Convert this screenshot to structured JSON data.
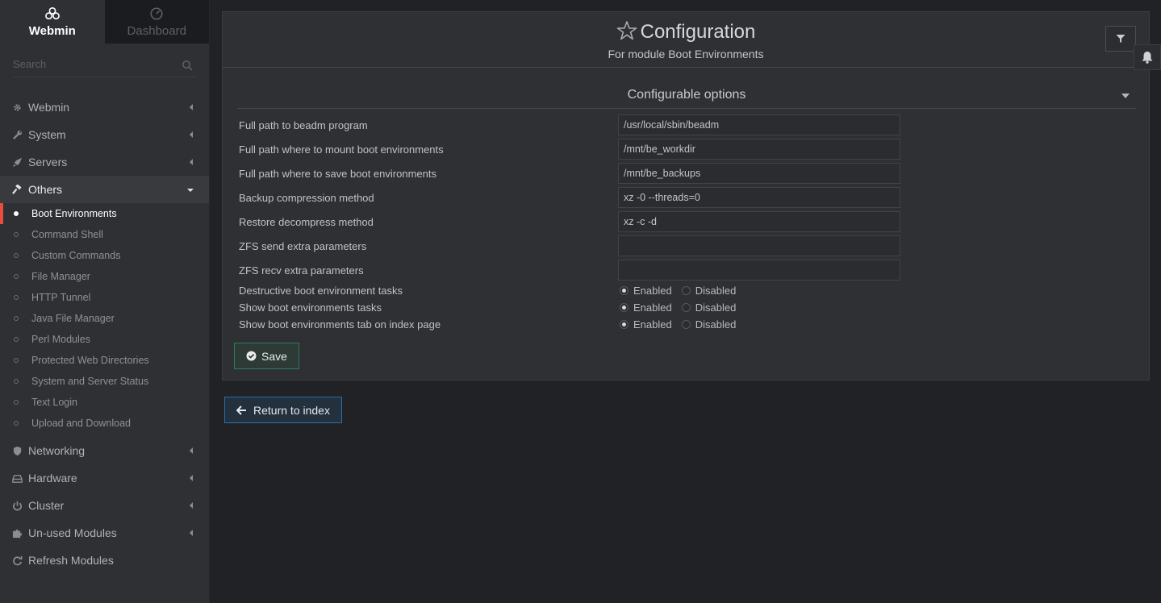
{
  "topnav": {
    "webmin_label": "Webmin",
    "dashboard_label": "Dashboard"
  },
  "search": {
    "placeholder": "Search"
  },
  "menu": {
    "categories_top": [
      {
        "label": "Webmin",
        "icon": "gear-icon"
      },
      {
        "label": "System",
        "icon": "wrench-icon"
      },
      {
        "label": "Servers",
        "icon": "rocket-icon"
      }
    ],
    "others": {
      "label": "Others",
      "icon": "gavel-icon"
    },
    "others_items": [
      "Boot Environments",
      "Command Shell",
      "Custom Commands",
      "File Manager",
      "HTTP Tunnel",
      "Java File Manager",
      "Perl Modules",
      "Protected Web Directories",
      "System and Server Status",
      "Text Login",
      "Upload and Download"
    ],
    "categories_bottom": [
      {
        "label": "Networking",
        "icon": "shield-icon"
      },
      {
        "label": "Hardware",
        "icon": "drive-icon"
      },
      {
        "label": "Cluster",
        "icon": "power-icon"
      },
      {
        "label": "Un-used Modules",
        "icon": "puzzle-icon"
      },
      {
        "label": "Refresh Modules",
        "icon": "refresh-icon"
      }
    ]
  },
  "header": {
    "title": "Configuration",
    "subtitle": "For module Boot Environments"
  },
  "section": {
    "title": "Configurable options"
  },
  "fields": [
    {
      "label": "Full path to beadm program",
      "value": "/usr/local/sbin/beadm"
    },
    {
      "label": "Full path where to mount boot environments",
      "value": "/mnt/be_workdir"
    },
    {
      "label": "Full path where to save boot environments",
      "value": "/mnt/be_backups"
    },
    {
      "label": "Backup compression method",
      "value": "xz -0 --threads=0"
    },
    {
      "label": "Restore decompress method",
      "value": "xz -c -d"
    },
    {
      "label": "ZFS send extra parameters",
      "value": ""
    },
    {
      "label": "ZFS recv extra parameters",
      "value": ""
    }
  ],
  "radios": [
    {
      "label": "Destructive boot environment tasks",
      "selected": "Enabled"
    },
    {
      "label": "Show boot environments tasks",
      "selected": "Enabled"
    },
    {
      "label": "Show boot environments tab on index page",
      "selected": "Enabled"
    }
  ],
  "radio_options": {
    "enabled": "Enabled",
    "disabled": "Disabled"
  },
  "buttons": {
    "save": "Save",
    "return": "Return to index"
  },
  "colors": {
    "accent_active": "#e74c3c",
    "save_border": "#2e7d5b",
    "return_border": "#2b6fa8"
  }
}
